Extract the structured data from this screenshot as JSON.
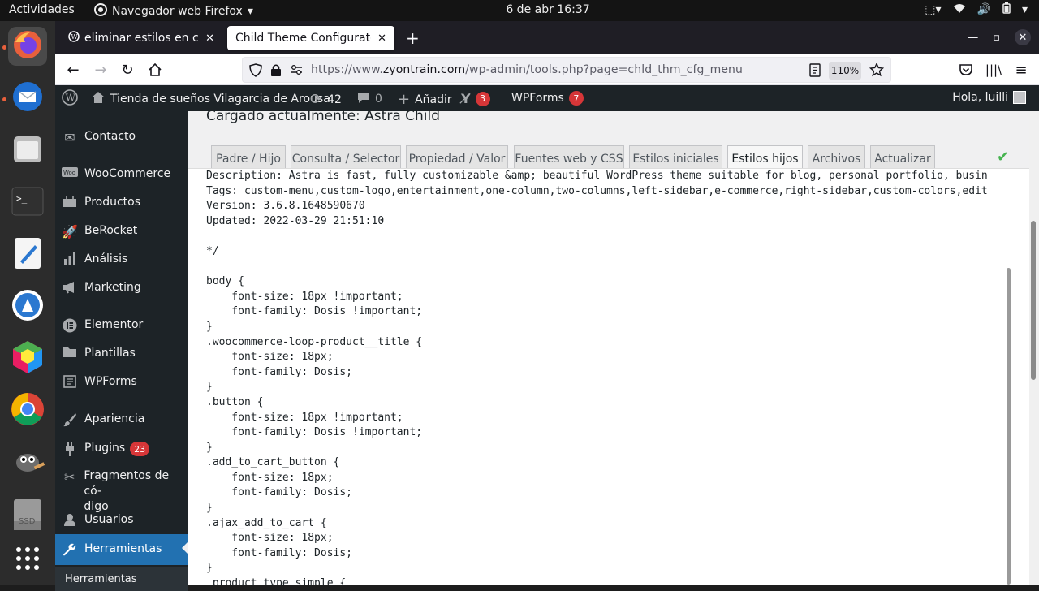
{
  "gnome": {
    "activities": "Actividades",
    "app_menu": "Navegador web Firefox",
    "clock": "6 de abr  16:37"
  },
  "dock": {
    "items": [
      {
        "name": "firefox",
        "icon": "firefox-icon",
        "color": "#e8603c"
      },
      {
        "name": "thunderbird",
        "icon": "thunderbird-icon",
        "color": "#2e87e5"
      },
      {
        "name": "files",
        "icon": "files-icon",
        "color": "#c9c9c9"
      },
      {
        "name": "terminal",
        "icon": "terminal-icon",
        "color": "#2d2d2d"
      },
      {
        "name": "text-editor",
        "icon": "text-editor-icon",
        "color": "#f5f5f5"
      },
      {
        "name": "app-installer",
        "icon": "app-installer-icon",
        "color": "#2b78d0"
      },
      {
        "name": "3d-app",
        "icon": "cube-icon",
        "color": "#4caf50"
      },
      {
        "name": "chrome",
        "icon": "chrome-icon",
        "color": "#db4437"
      },
      {
        "name": "gimp",
        "icon": "gimp-icon",
        "color": "#6d6d6d"
      },
      {
        "name": "ssd",
        "icon": "drive-icon",
        "color": "#8c8c8c"
      },
      {
        "name": "show-apps",
        "icon": "apps-grid-icon",
        "color": "#ffffff"
      }
    ],
    "ssd_label": "SSD"
  },
  "browser": {
    "tabs": [
      {
        "title": "eliminar estilos en child t"
      },
      {
        "title": "Child Theme Configurator <"
      }
    ],
    "url_prefix": "https://www.",
    "url_domain": "zyontrain.com",
    "url_path": "/wp-admin/tools.php?page=chld_thm_cfg_menu",
    "zoom": "110%"
  },
  "adminbar": {
    "site_name": "Tienda de sueños Vilagarcia de Arousa",
    "updates": "42",
    "comments": "0",
    "add_new": "Añadir",
    "yoast_count": "3",
    "wpforms": "WPForms",
    "wpforms_count": "7",
    "greeting": "Hola, luilli"
  },
  "sidebar": {
    "items": [
      {
        "label": "Contacto",
        "icon": "mail-icon"
      },
      {
        "label": "WooCommerce",
        "icon": "woocommerce-icon"
      },
      {
        "label": "Productos",
        "icon": "products-icon"
      },
      {
        "label": "BeRocket",
        "icon": "rocket-icon"
      },
      {
        "label": "Análisis",
        "icon": "chart-icon"
      },
      {
        "label": "Marketing",
        "icon": "megaphone-icon"
      },
      {
        "label": "Elementor",
        "icon": "elementor-icon"
      },
      {
        "label": "Plantillas",
        "icon": "folder-icon"
      },
      {
        "label": "WPForms",
        "icon": "forms-icon"
      },
      {
        "label": "Apariencia",
        "icon": "brush-icon"
      },
      {
        "label": "Plugins",
        "icon": "plugin-icon",
        "badge": "23"
      },
      {
        "label": "Fragmentos de có-",
        "label2": "digo",
        "icon": "scissors-icon"
      },
      {
        "label": "Usuarios",
        "icon": "user-icon"
      },
      {
        "label": "Herramientas",
        "icon": "wrench-icon",
        "current": true
      }
    ],
    "submenu_first": "Herramientas"
  },
  "main": {
    "loaded_label": "Cargado actualmente: Astra Child",
    "tabs": [
      {
        "label": "Padre / Hijo"
      },
      {
        "label": "Consulta / Selector"
      },
      {
        "label": "Propiedad / Valor"
      },
      {
        "label": "Fuentes web y CSS"
      },
      {
        "label": "Estilos iniciales"
      },
      {
        "label": "Estilos hijos",
        "selected": true
      },
      {
        "label": "Archivos"
      },
      {
        "label": "Actualizar"
      }
    ],
    "code_lines": [
      "Description: Astra is fast, fully customizable &amp; beautiful WordPress theme suitable for blog, personal portfolio, busin",
      "Tags: custom-menu,custom-logo,entertainment,one-column,two-columns,left-sidebar,e-commerce,right-sidebar,custom-colors,edit",
      "Version: 3.6.8.1648590670",
      "Updated: 2022-03-29 21:51:10",
      "",
      "*/",
      "",
      "body {",
      "    font-size: 18px !important;",
      "    font-family: Dosis !important;",
      "}",
      ".woocommerce-loop-product__title {",
      "    font-size: 18px;",
      "    font-family: Dosis;",
      "}",
      ".button {",
      "    font-size: 18px !important;",
      "    font-family: Dosis !important;",
      "}",
      ".add_to_cart_button {",
      "    font-size: 18px;",
      "    font-family: Dosis;",
      "}",
      ".ajax_add_to_cart {",
      "    font-size: 18px;",
      "    font-family: Dosis;",
      "}",
      ".product_type_simple {"
    ]
  }
}
